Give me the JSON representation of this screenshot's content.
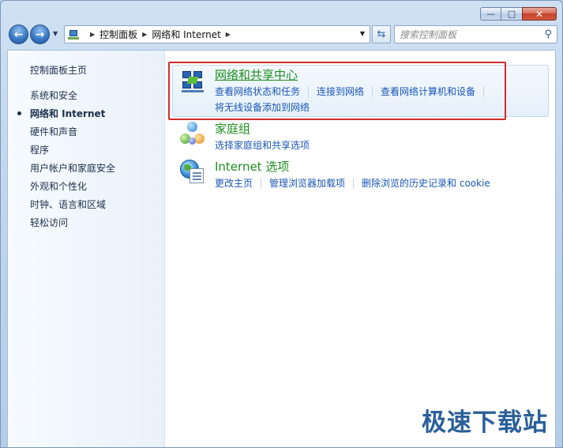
{
  "window": {
    "minimize_label": "—",
    "maximize_label": "□",
    "close_label": "✕"
  },
  "navigation": {
    "back_icon": "←",
    "forward_icon": "→",
    "history_dropdown_icon": "▼",
    "breadcrumb": [
      "控制面板",
      "网络和 Internet"
    ],
    "breadcrumb_separator": "▶",
    "address_dropdown_icon": "▼",
    "refresh_icon": "⇆",
    "search_placeholder": "搜索控制面板",
    "search_icon": "⚲"
  },
  "sidebar": {
    "items": [
      {
        "label": "控制面板主页"
      },
      {
        "label": "系统和安全"
      },
      {
        "label": "网络和 Internet",
        "active": true
      },
      {
        "label": "硬件和声音"
      },
      {
        "label": "程序"
      },
      {
        "label": "用户帐户和家庭安全"
      },
      {
        "label": "外观和个性化"
      },
      {
        "label": "时钟、语言和区域"
      },
      {
        "label": "轻松访问"
      }
    ]
  },
  "categories": [
    {
      "title": "网络和共享中心",
      "icon": "network-sharing-center-icon",
      "links": [
        "查看网络状态和任务",
        "连接到网络",
        "查看网络计算机和设备"
      ],
      "links_second_row": [
        "将无线设备添加到网络"
      ]
    },
    {
      "title": "家庭组",
      "icon": "homegroup-icon",
      "links": [
        "选择家庭组和共享选项"
      ]
    },
    {
      "title": "Internet 选项",
      "icon": "internet-options-icon",
      "links": [
        "更改主页",
        "管理浏览器加载项",
        "删除浏览的历史记录和 cookie"
      ]
    }
  ],
  "watermark": "极速下载站",
  "colors": {
    "link": "#1a56b5",
    "category_title": "#1e8e1e",
    "highlight_border": "#d32b2b"
  }
}
